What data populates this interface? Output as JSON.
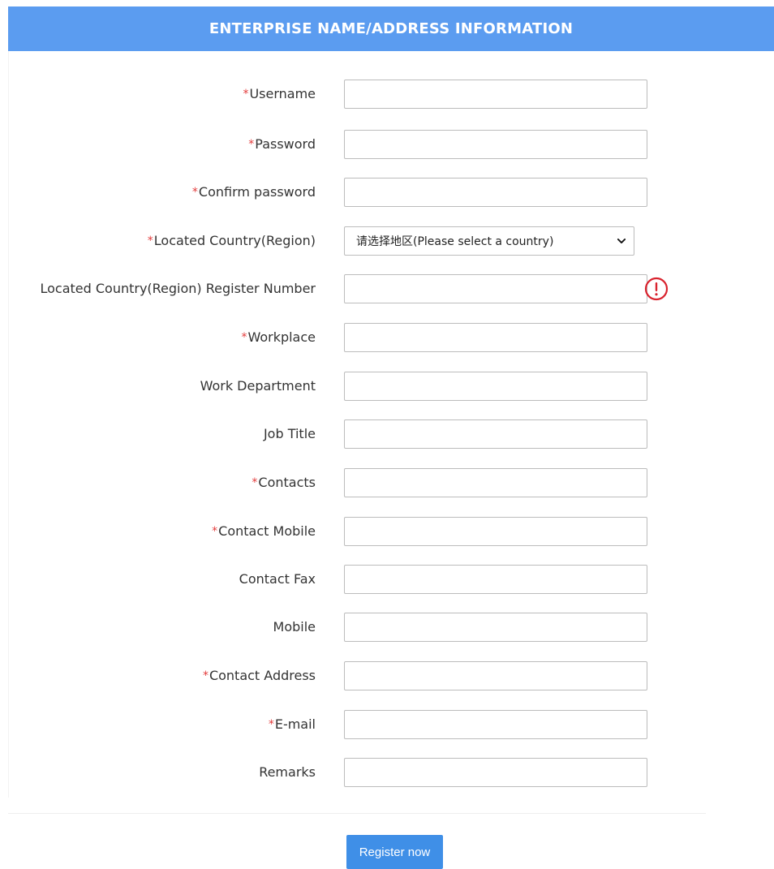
{
  "header": {
    "title": "ENTERPRISE NAME/ADDRESS INFORMATION"
  },
  "form": {
    "fields": [
      {
        "label": "Username",
        "required": "*",
        "value": ""
      },
      {
        "label": "Password",
        "required": "*",
        "value": ""
      },
      {
        "label": "Confirm password",
        "required": "*",
        "value": ""
      },
      {
        "label": "Located Country(Region)",
        "required": "*",
        "selected": "请选择地区(Please select a country)"
      },
      {
        "label": "Located Country(Region) Register Number",
        "required": "",
        "value": ""
      },
      {
        "label": "Workplace",
        "required": "*",
        "value": ""
      },
      {
        "label": "Work Department",
        "required": "",
        "value": ""
      },
      {
        "label": "Job Title",
        "required": "",
        "value": ""
      },
      {
        "label": "Contacts",
        "required": "*",
        "value": ""
      },
      {
        "label": "Contact Mobile",
        "required": "*",
        "value": ""
      },
      {
        "label": "Contact Fax",
        "required": "",
        "value": ""
      },
      {
        "label": "Mobile",
        "required": "",
        "value": ""
      },
      {
        "label": "Contact Address",
        "required": "*",
        "value": ""
      },
      {
        "label": "E-mail",
        "required": "*",
        "value": ""
      },
      {
        "label": "Remarks",
        "required": "",
        "value": ""
      }
    ]
  },
  "actions": {
    "register_label": "Register now"
  },
  "icons": {
    "warning": "exclamation-circle-icon",
    "dropdown": "chevron-down-icon"
  },
  "colors": {
    "header_bg": "#5b9cf0",
    "button_bg": "#3f8fe7",
    "required_mark": "#e33b3b",
    "warning": "#d9232e"
  }
}
